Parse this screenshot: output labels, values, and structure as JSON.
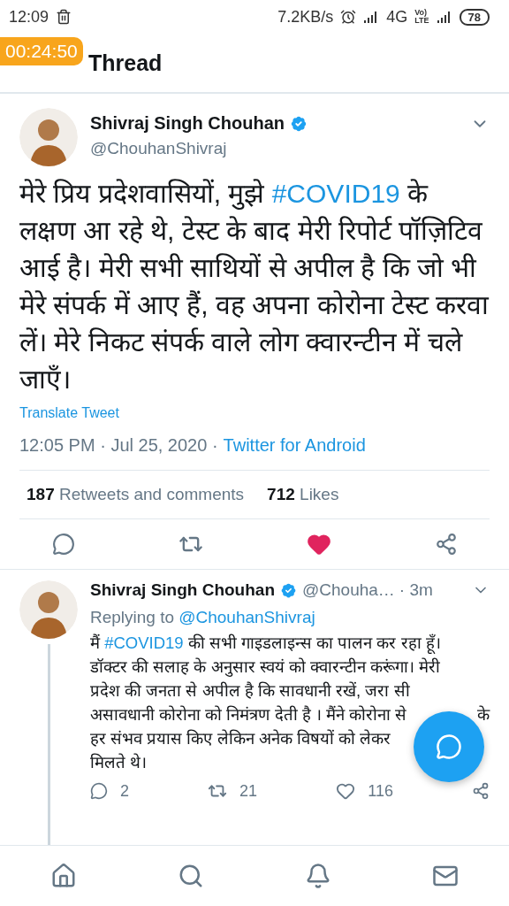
{
  "status_bar": {
    "time": "12:09",
    "speed": "7.2KB/s",
    "network": "4G",
    "volte_top": "Vo)",
    "volte_bottom": "LTE",
    "battery": "78"
  },
  "recorder_badge": "00:24:50",
  "header": {
    "title": "Thread"
  },
  "tweet": {
    "name": "Shivraj Singh Chouhan",
    "verified": true,
    "handle": "@ChouhanShivraj",
    "segments": [
      {
        "kind": "text",
        "text": "मेरे प्रिय प्रदेशवासियों, मुझे "
      },
      {
        "kind": "hashtag",
        "text": "#COVID19"
      },
      {
        "kind": "text",
        "text": " के लक्षण आ रहे थे, टेस्ट के बाद मेरी रिपोर्ट पॉज़िटिव आई है। मेरी सभी साथियों से अपील है कि जो भी मेरे संपर्क में आए हैं, वह अपना कोरोना टेस्ट करवा लें। मेरे निकट संपर्क वाले लोग क्वारन्टीन में चले जाएँ।"
      }
    ],
    "translate": "Translate Tweet",
    "timestamp": "12:05 PM · Jul 25, 2020 ·",
    "source": "Twitter for Android",
    "stats": [
      "**187** Retweets and comments",
      "**712** Likes"
    ],
    "liked": true
  },
  "reply": {
    "name": "Shivraj Singh Chouhan",
    "verified": true,
    "handle": "@Chouha…",
    "time": "· 3m",
    "replying_label": "Replying to",
    "replying_handle": "@ChouhanShivraj",
    "lines": [
      {
        "segments": [
          {
            "kind": "text",
            "text": "मैं "
          },
          {
            "kind": "hashtag",
            "text": "#COVID19"
          },
          {
            "kind": "text",
            "text": " की सभी गाइडलाइन्स का पालन कर रहा हूँ।"
          }
        ]
      },
      {
        "segments": [
          {
            "kind": "text",
            "text": "डॉक्टर की सलाह के अनुसार स्वयं को क्वारन्टीन करूंगा। मेरी"
          }
        ]
      },
      {
        "segments": [
          {
            "kind": "text",
            "text": "प्रदेश की जनता से अपील है कि सावधानी रखें, जरा सी"
          }
        ]
      },
      {
        "segments": [
          {
            "kind": "text",
            "text": "असावधानी कोरोना को निमंत्रण देती है । मैंने कोरोना से"
          }
        ],
        "tail": "के"
      },
      {
        "segments": [
          {
            "kind": "text",
            "text": "हर संभव प्रयास किए लेकिन अनेक विषयों को लेकर"
          }
        ]
      },
      {
        "segments": [
          {
            "kind": "text",
            "text": "मिलते थे।"
          }
        ]
      }
    ],
    "replies": "2",
    "retweets": "21",
    "likes": "116",
    "liked": false
  }
}
